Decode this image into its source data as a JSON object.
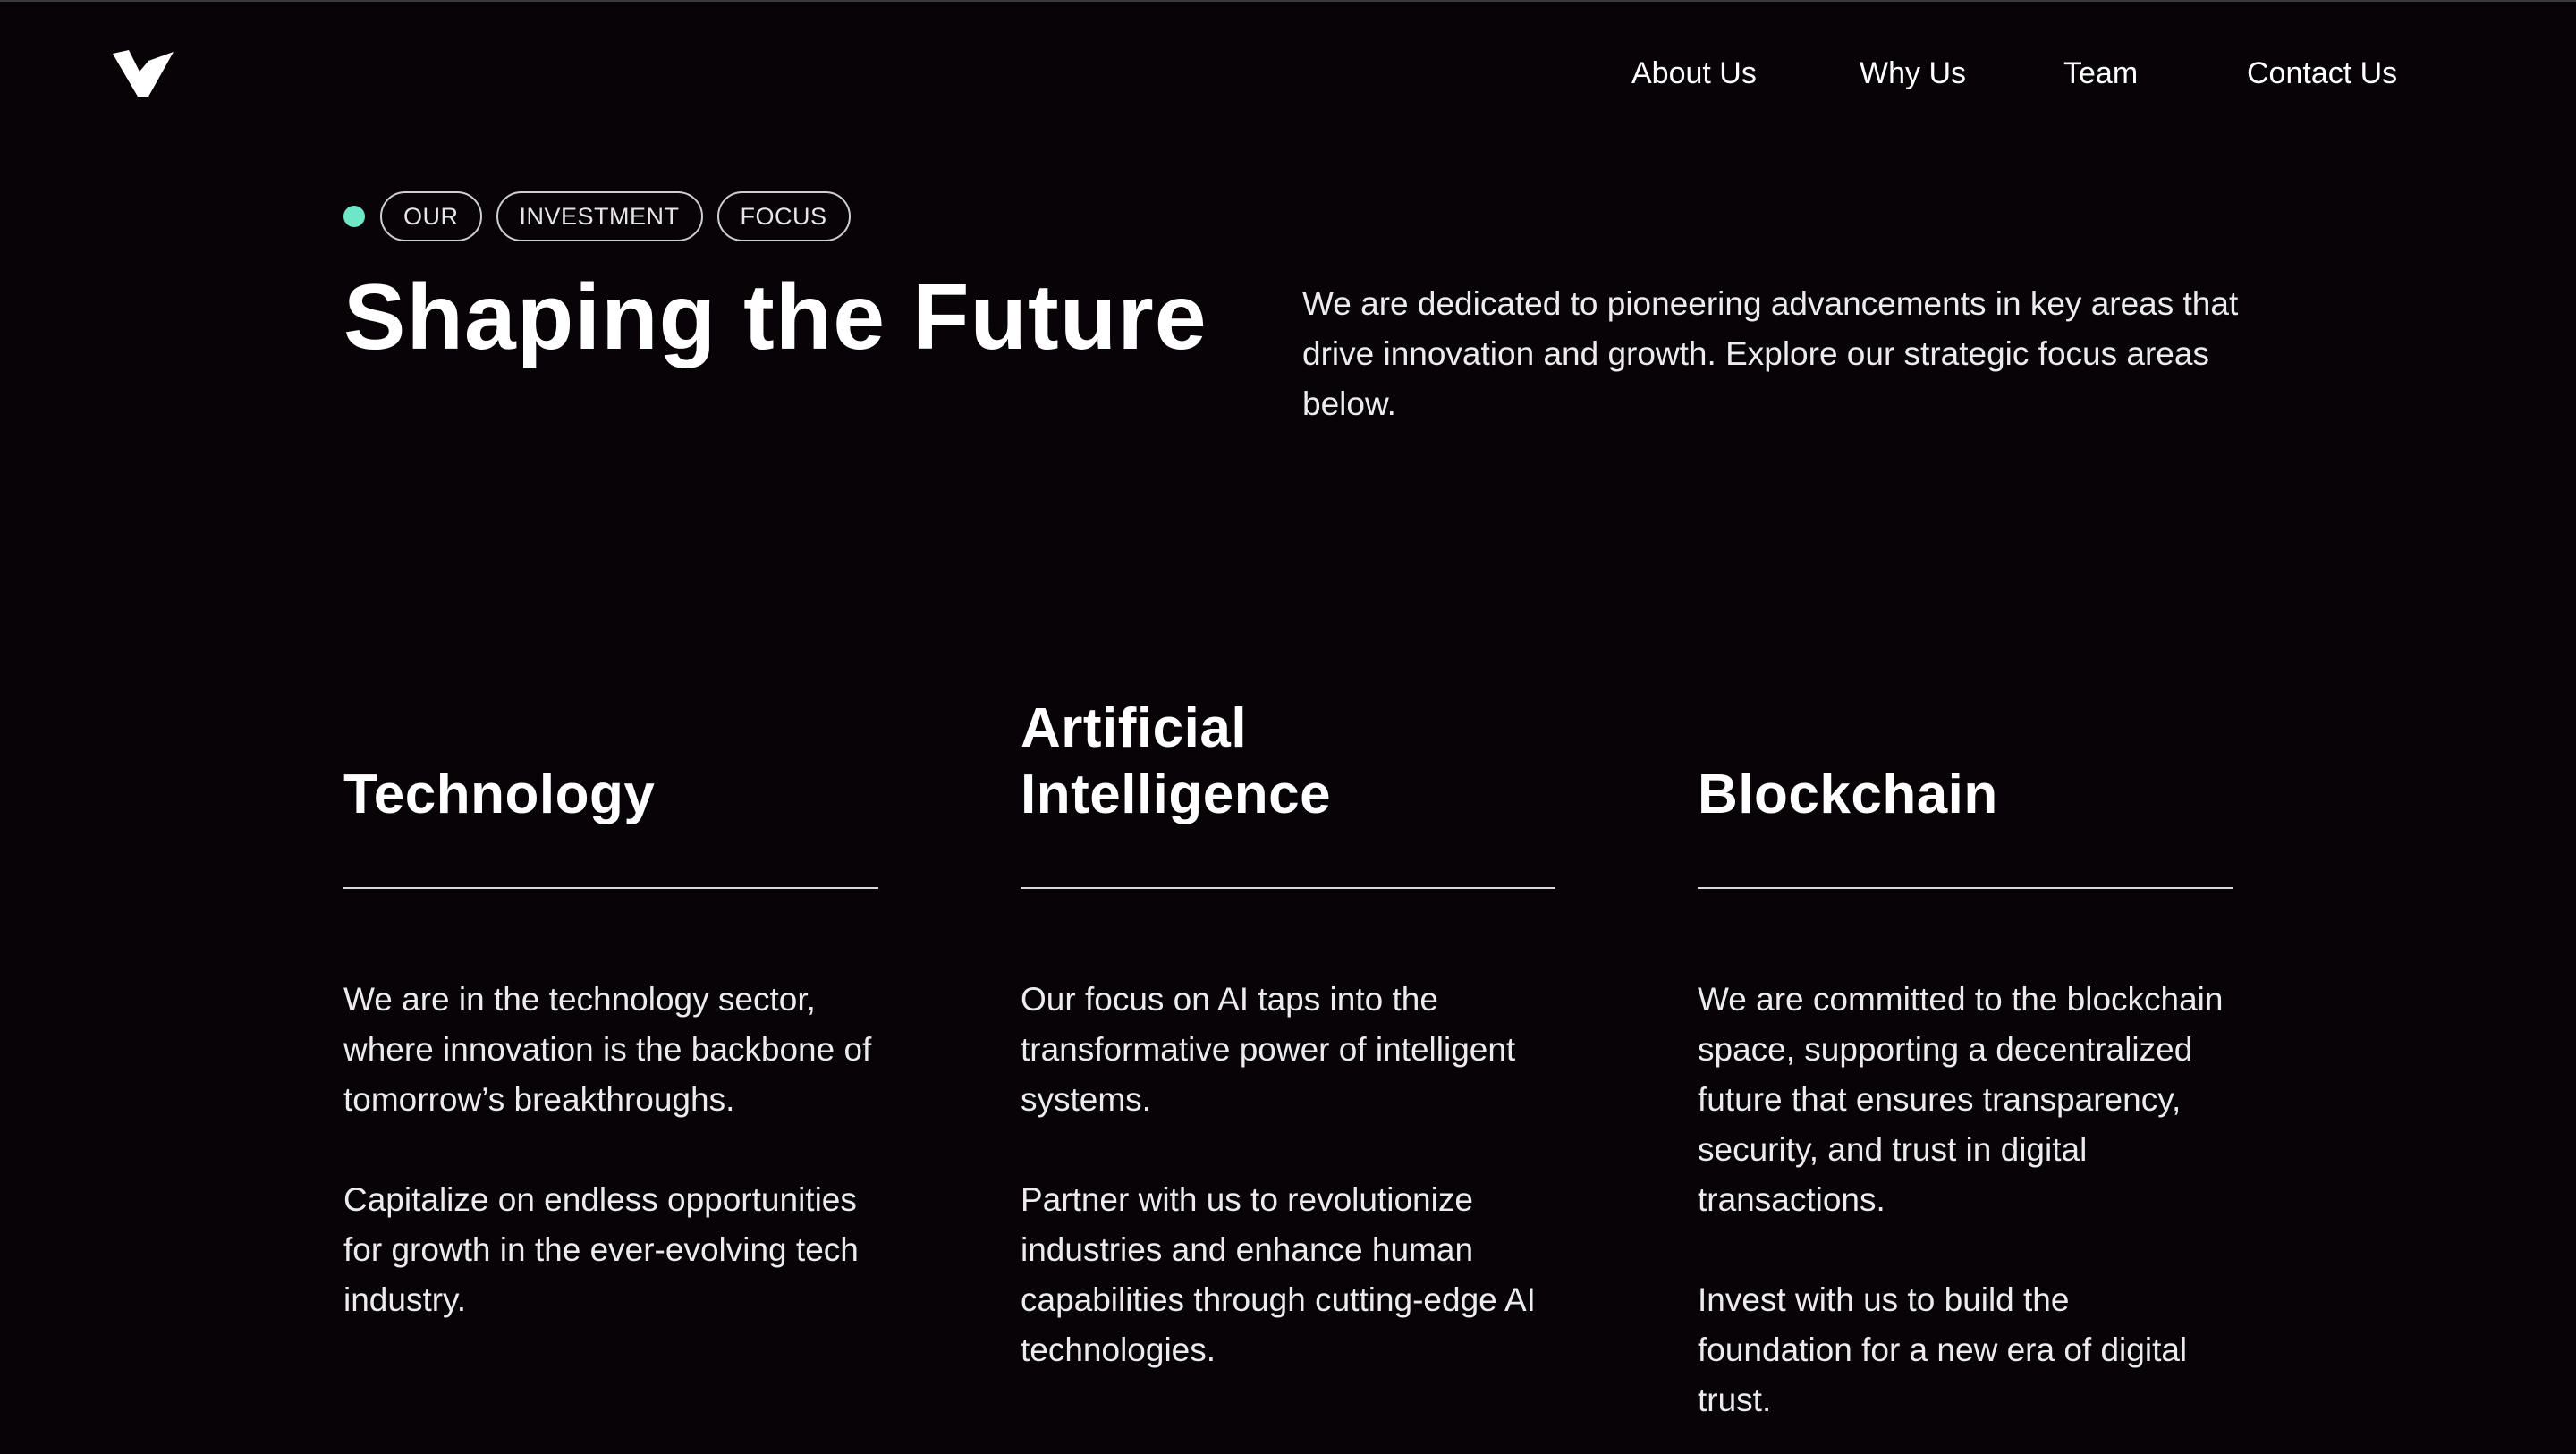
{
  "header": {
    "logo": "v-checkmark-logo",
    "nav": {
      "about": "About Us",
      "why": "Why Us",
      "team": "Team",
      "contact": "Contact Us"
    }
  },
  "hero": {
    "tags": [
      "OUR",
      "INVESTMENT",
      "FOCUS"
    ],
    "title": "Shaping the Future",
    "intro": "We are dedicated to pioneering advancements in key areas that drive innovation and growth. Explore our strategic focus areas below."
  },
  "focus_areas": [
    {
      "title": "Technology",
      "p1": "We are in the technology sector, where innovation is the backbone of tomorrow’s breakthroughs.",
      "p2": "Capitalize on endless opportunities for growth in the ever-evolving tech industry."
    },
    {
      "title": "Artificial Intelligence",
      "p1": "Our focus on AI taps into the transformative power of intelligent systems.",
      "p2": "Partner with us to revolutionize industries and enhance human capabilities through cutting-edge AI technologies."
    },
    {
      "title": "Blockchain",
      "p1": "We are committed to the blockchain space, supporting a decentralized future that ensures transparency, security, and trust in digital transactions.",
      "p2": "Invest with us to build the foundation for a new era of digital trust."
    }
  ],
  "colors": {
    "background": "#070306",
    "accent": "#6ee7c6",
    "text": "#ffffff"
  }
}
